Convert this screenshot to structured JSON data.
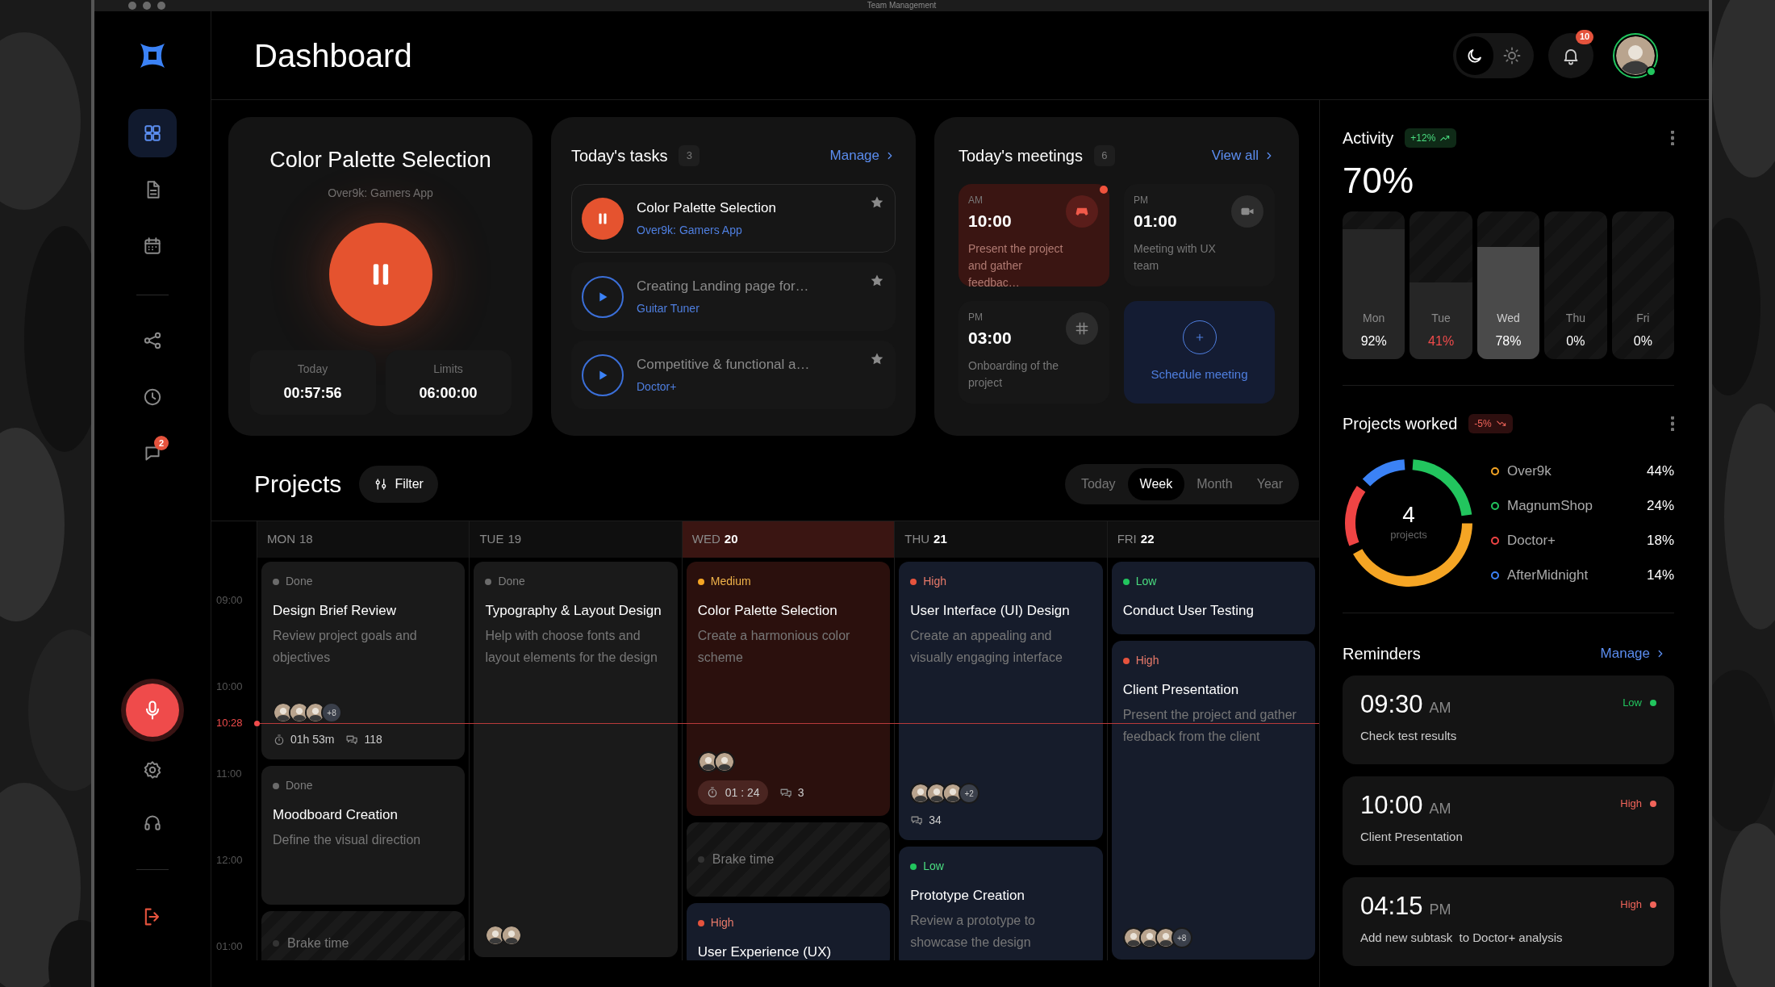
{
  "window": {
    "title": "Team Management"
  },
  "sidebar": {
    "items": [
      {
        "selected": true
      },
      {
        "selected": false
      },
      {
        "selected": false
      },
      {
        "selected": false
      },
      {
        "selected": false
      },
      {
        "selected": false,
        "badge": "2"
      }
    ]
  },
  "header": {
    "title": "Dashboard",
    "theme_toggle": [
      {
        "selected": true
      },
      {
        "selected": false
      }
    ],
    "notifications": "10",
    "online": true
  },
  "timer": {
    "title": "Color Palette Selection",
    "project": "Over9k: Gamers App",
    "running": true,
    "stats": [
      {
        "label": "Today",
        "value": "00:57:56"
      },
      {
        "label": "Limits",
        "value": "06:00:00"
      }
    ]
  },
  "tasks": {
    "title": "Today's tasks",
    "count": "3",
    "link": "Manage",
    "items": [
      {
        "title": "Color Palette Selection",
        "project": "Over9k: Gamers App",
        "running": true
      },
      {
        "title": "Creating Landing page for…",
        "project": "Guitar Tuner",
        "running": false
      },
      {
        "title": "Competitive & functional a…",
        "project": "Doctor+",
        "running": false
      }
    ]
  },
  "meetings": {
    "title": "Today's meetings",
    "count": "6",
    "link": "View all",
    "items": [
      {
        "kind": "meeting",
        "period": "AM",
        "time": "10:00",
        "text": "Present the project and gather feedbac…",
        "selected": true,
        "unread": true
      },
      {
        "kind": "meeting",
        "period": "PM",
        "time": "01:00",
        "text": "Meeting with UX team",
        "selected": false,
        "unread": false
      },
      {
        "kind": "meeting",
        "period": "PM",
        "time": "03:00",
        "text": "Onboarding of the project",
        "selected": false,
        "unread": false
      },
      {
        "kind": "action",
        "text": "Schedule meeting"
      }
    ]
  },
  "projects": {
    "title": "Projects",
    "filter": "Filter",
    "ranges": [
      {
        "label": "Today",
        "selected": false
      },
      {
        "label": "Week",
        "selected": true
      },
      {
        "label": "Month",
        "selected": false
      },
      {
        "label": "Year",
        "selected": false
      }
    ]
  },
  "calendar": {
    "times": [
      {
        "label": "09:00",
        "current": false
      },
      {
        "label": "10:00",
        "current": false
      },
      {
        "label": "10:28",
        "current": true
      },
      {
        "label": "11:00",
        "current": false
      },
      {
        "label": "12:00",
        "current": false
      },
      {
        "label": "01:00",
        "current": false
      }
    ],
    "days": [
      {
        "name": "MON",
        "number": "18",
        "past": true,
        "selected": false,
        "events": [
          {
            "kind": "done",
            "status": "Done",
            "title": "Design Brief Review",
            "text": "Review project goals and objectives",
            "avatars_more": "+8",
            "duration": "01h 53m",
            "comments": "118"
          },
          {
            "kind": "done",
            "status": "Done",
            "title": "Moodboard Creation",
            "text": "Define the visual direction"
          },
          {
            "kind": "break",
            "text": "Brake time"
          }
        ]
      },
      {
        "name": "TUE",
        "number": "19",
        "past": true,
        "selected": false,
        "events": [
          {
            "kind": "done",
            "status": "Done",
            "title": "Typography & Layout Design",
            "text": "Help with choose fonts and layout elements for the design"
          }
        ]
      },
      {
        "name": "WED",
        "number": "20",
        "past": false,
        "selected": true,
        "events": [
          {
            "kind": "medium",
            "status": "Medium",
            "title": "Color Palette Selection",
            "text": "Create a harmonious color scheme",
            "timer": "01 : 24",
            "comments": "3"
          },
          {
            "kind": "break",
            "text": "Brake time"
          },
          {
            "kind": "high",
            "status": "High",
            "title": "User Experience (UX)"
          }
        ]
      },
      {
        "name": "THU",
        "number": "21",
        "past": false,
        "selected": false,
        "events": [
          {
            "kind": "high",
            "status": "High",
            "title": "User Interface (UI) Design",
            "text": "Create an appealing and visually engaging interface",
            "avatars_more": "+2",
            "comments": "34"
          },
          {
            "kind": "low",
            "status": "Low",
            "title": "Prototype Creation",
            "text": "Review a prototype to showcase the design"
          }
        ]
      },
      {
        "name": "FRI",
        "number": "22",
        "past": false,
        "selected": false,
        "events": [
          {
            "kind": "low",
            "status": "Low",
            "title": "Conduct User Testing"
          },
          {
            "kind": "high",
            "status": "High",
            "title": "Client Presentation",
            "text": "Present the project and gather feedback from the client",
            "avatars_more": "+8"
          }
        ]
      }
    ]
  },
  "activity": {
    "title": "Activity",
    "change": "+12%",
    "rising": true,
    "value": "70%",
    "days": [
      {
        "label": "Mon",
        "reading": "92%",
        "level": 0.88,
        "selected": false,
        "warning": false
      },
      {
        "label": "Tue",
        "reading": "41%",
        "level": 0.52,
        "selected": false,
        "warning": true
      },
      {
        "label": "Wed",
        "reading": "78%",
        "level": 0.76,
        "selected": true,
        "warning": false
      },
      {
        "label": "Thu",
        "reading": "0%",
        "level": 0,
        "selected": false,
        "warning": false
      },
      {
        "label": "Fri",
        "reading": "0%",
        "level": 0,
        "selected": false,
        "warning": false
      }
    ]
  },
  "projects_worked": {
    "title": "Projects worked",
    "change": "-5%",
    "rising": false,
    "total": "4",
    "total_label": "projects",
    "legend": [
      {
        "share": "44%",
        "color": "#f5a524"
      },
      {
        "share": "24%",
        "color": "#22c55e"
      },
      {
        "share": "18%",
        "color": "#ef4444"
      },
      {
        "share": "14%",
        "color": "#3b82f6"
      }
    ],
    "chart_data": {
      "type": "donut",
      "categories": [
        "Over9k",
        "MagnumShop",
        "Doctor+",
        "AfterMidnight"
      ],
      "values": [
        44,
        24,
        18,
        14
      ]
    }
  },
  "reminders": {
    "title": "Reminders",
    "link": "Manage",
    "items": [
      {
        "time": "09:30",
        "period": "AM",
        "text": "Check test results",
        "label": "Low",
        "color": "#22c55e"
      },
      {
        "time": "10:00",
        "period": "AM",
        "text": "Client Presentation",
        "label": "High",
        "color": "#f0645a"
      },
      {
        "time": "04:15",
        "period": "PM",
        "text": "Add new subtask  to Doctor+ analysis",
        "label": "High",
        "color": "#f0645a"
      }
    ]
  }
}
